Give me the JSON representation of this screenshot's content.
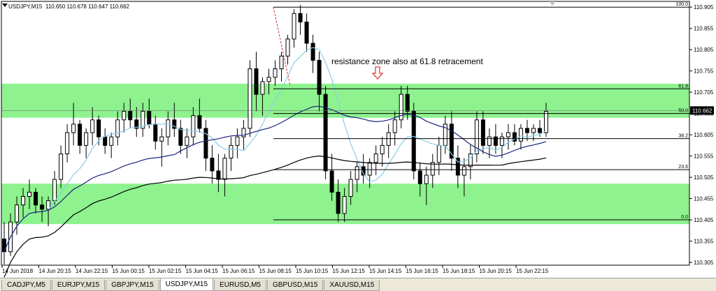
{
  "header": {
    "symbol_timeframe": "USDJPY,M15",
    "ohlc": "110.650 110.678 110.647 110.662"
  },
  "annotation": "resistance zone also at 61.8 retracement",
  "fib_levels": [
    {
      "label": "100.0",
      "price": 110.905
    },
    {
      "label": "61.8",
      "price": 110.713
    },
    {
      "label": "50.0",
      "price": 110.655
    },
    {
      "label": "38.2",
      "price": 110.596
    },
    {
      "label": "23.6",
      "price": 110.523
    },
    {
      "label": "0.0",
      "price": 110.405
    }
  ],
  "current_price": "110.662",
  "price_axis_labels": [
    "110.905",
    "110.855",
    "110.805",
    "110.755",
    "110.705",
    "110.655",
    "110.605",
    "110.555",
    "110.505",
    "110.455",
    "110.405",
    "110.355",
    "110.305"
  ],
  "time_axis_labels": [
    "14 Jun 2018",
    "14 Jun 20:15",
    "14 Jun 22:15",
    "15 Jun 00:15",
    "15 Jun 02:15",
    "15 Jun 04:15",
    "15 Jun 06:15",
    "15 Jun 08:15",
    "15 Jun 10:15",
    "15 Jun 12:15",
    "15 Jun 14:15",
    "15 Jun 16:15",
    "15 Jun 18:15",
    "15 Jun 20:15",
    "15 Jun 22:15"
  ],
  "zones": [
    {
      "from": 110.645,
      "to": 110.725
    },
    {
      "from": 110.395,
      "to": 110.49
    }
  ],
  "colors": {
    "zone": "#8ef28e",
    "fast_ma": "#87ceeb",
    "mid_ma": "#1a237e",
    "slow_ma": "#000000",
    "fib": "#000000",
    "arrow": "#e53935",
    "candle": "#000000"
  },
  "tabs": [
    {
      "label": "CADJPY,M5",
      "active": false
    },
    {
      "label": "EURJPY,M15",
      "active": false
    },
    {
      "label": "GBPJPY,M15",
      "active": false
    },
    {
      "label": "USDJPY,M15",
      "active": true
    },
    {
      "label": "EURUSD,M5",
      "active": false
    },
    {
      "label": "GBPUSD,M15",
      "active": false
    },
    {
      "label": "XAUUSD,M15",
      "active": false
    }
  ],
  "chart_data": {
    "type": "candlestick",
    "symbol": "USDJPY",
    "timeframe": "M15",
    "ylim": [
      110.305,
      110.925
    ],
    "candles": [
      [
        110.36,
        110.4,
        110.3,
        110.33
      ],
      [
        110.33,
        110.42,
        110.32,
        110.4
      ],
      [
        110.4,
        110.46,
        110.37,
        110.44
      ],
      [
        110.44,
        110.48,
        110.41,
        110.46
      ],
      [
        110.46,
        110.5,
        110.43,
        110.47
      ],
      [
        110.47,
        110.48,
        110.42,
        110.44
      ],
      [
        110.44,
        110.46,
        110.4,
        110.43
      ],
      [
        110.43,
        110.46,
        110.39,
        110.45
      ],
      [
        110.45,
        110.52,
        110.44,
        110.5
      ],
      [
        110.5,
        110.58,
        110.48,
        110.56
      ],
      [
        110.56,
        110.63,
        110.54,
        110.61
      ],
      [
        110.61,
        110.68,
        110.58,
        110.63
      ],
      [
        110.63,
        110.64,
        110.56,
        110.58
      ],
      [
        110.58,
        110.62,
        110.55,
        110.61
      ],
      [
        110.61,
        110.67,
        110.58,
        110.64
      ],
      [
        110.64,
        110.65,
        110.58,
        110.6
      ],
      [
        110.6,
        110.62,
        110.56,
        110.58
      ],
      [
        110.58,
        110.61,
        110.55,
        110.6
      ],
      [
        110.6,
        110.66,
        110.58,
        110.64
      ],
      [
        110.64,
        110.68,
        110.61,
        110.66
      ],
      [
        110.66,
        110.69,
        110.62,
        110.64
      ],
      [
        110.64,
        110.67,
        110.6,
        110.62
      ],
      [
        110.62,
        110.68,
        110.6,
        110.66
      ],
      [
        110.66,
        110.69,
        110.62,
        110.63
      ],
      [
        110.63,
        110.65,
        110.57,
        110.59
      ],
      [
        110.59,
        110.62,
        110.53,
        110.6
      ],
      [
        110.6,
        110.66,
        110.58,
        110.64
      ],
      [
        110.64,
        110.68,
        110.6,
        110.62
      ],
      [
        110.62,
        110.64,
        110.56,
        110.58
      ],
      [
        110.58,
        110.62,
        110.55,
        110.6
      ],
      [
        110.6,
        110.67,
        110.58,
        110.65
      ],
      [
        110.65,
        110.69,
        110.61,
        110.62
      ],
      [
        110.62,
        110.64,
        110.52,
        110.55
      ],
      [
        110.55,
        110.58,
        110.49,
        110.52
      ],
      [
        110.52,
        110.56,
        110.47,
        110.5
      ],
      [
        110.5,
        110.56,
        110.46,
        110.55
      ],
      [
        110.55,
        110.6,
        110.52,
        110.58
      ],
      [
        110.58,
        110.62,
        110.55,
        110.6
      ],
      [
        110.6,
        110.64,
        110.57,
        110.62
      ],
      [
        110.62,
        110.78,
        110.6,
        110.76
      ],
      [
        110.76,
        110.8,
        110.66,
        110.7
      ],
      [
        110.7,
        110.74,
        110.65,
        110.73
      ],
      [
        110.73,
        110.76,
        110.7,
        110.74
      ],
      [
        110.74,
        110.78,
        110.72,
        110.76
      ],
      [
        110.76,
        110.8,
        110.73,
        110.79
      ],
      [
        110.79,
        110.84,
        110.77,
        110.83
      ],
      [
        110.83,
        110.9,
        110.81,
        110.89
      ],
      [
        110.89,
        110.91,
        110.84,
        110.87
      ],
      [
        110.87,
        110.89,
        110.8,
        110.82
      ],
      [
        110.82,
        110.84,
        110.75,
        110.78
      ],
      [
        110.78,
        110.8,
        110.66,
        110.7
      ],
      [
        110.7,
        110.72,
        110.5,
        110.52
      ],
      [
        110.52,
        110.56,
        110.45,
        110.47
      ],
      [
        110.47,
        110.5,
        110.4,
        110.42
      ],
      [
        110.42,
        110.48,
        110.4,
        110.46
      ],
      [
        110.46,
        110.52,
        110.44,
        110.5
      ],
      [
        110.5,
        110.54,
        110.47,
        110.53
      ],
      [
        110.53,
        110.56,
        110.49,
        110.51
      ],
      [
        110.51,
        110.55,
        110.48,
        110.54
      ],
      [
        110.54,
        110.58,
        110.51,
        110.56
      ],
      [
        110.56,
        110.6,
        110.53,
        110.58
      ],
      [
        110.58,
        110.63,
        110.55,
        110.61
      ],
      [
        110.61,
        110.66,
        110.58,
        110.64
      ],
      [
        110.64,
        110.72,
        110.62,
        110.7
      ],
      [
        110.7,
        110.72,
        110.64,
        110.66
      ],
      [
        110.66,
        110.68,
        110.5,
        110.52
      ],
      [
        110.52,
        110.54,
        110.46,
        110.49
      ],
      [
        110.49,
        110.53,
        110.44,
        110.51
      ],
      [
        110.51,
        110.56,
        110.48,
        110.54
      ],
      [
        110.54,
        110.6,
        110.51,
        110.58
      ],
      [
        110.58,
        110.65,
        110.56,
        110.63
      ],
      [
        110.63,
        110.66,
        110.52,
        110.55
      ],
      [
        110.55,
        110.58,
        110.48,
        110.51
      ],
      [
        110.51,
        110.55,
        110.46,
        110.53
      ],
      [
        110.53,
        110.58,
        110.5,
        110.56
      ],
      [
        110.56,
        110.66,
        110.54,
        110.64
      ],
      [
        110.64,
        110.66,
        110.56,
        110.58
      ],
      [
        110.58,
        110.62,
        110.55,
        110.6
      ],
      [
        110.6,
        110.63,
        110.56,
        110.58
      ],
      [
        110.58,
        110.61,
        110.55,
        110.6
      ],
      [
        110.6,
        110.63,
        110.57,
        110.61
      ],
      [
        110.61,
        110.63,
        110.58,
        110.59
      ],
      [
        110.59,
        110.63,
        110.57,
        110.62
      ],
      [
        110.62,
        110.64,
        110.59,
        110.61
      ],
      [
        110.61,
        110.63,
        110.59,
        110.62
      ],
      [
        110.62,
        110.64,
        110.6,
        110.61
      ],
      [
        110.61,
        110.68,
        110.6,
        110.66
      ]
    ]
  }
}
